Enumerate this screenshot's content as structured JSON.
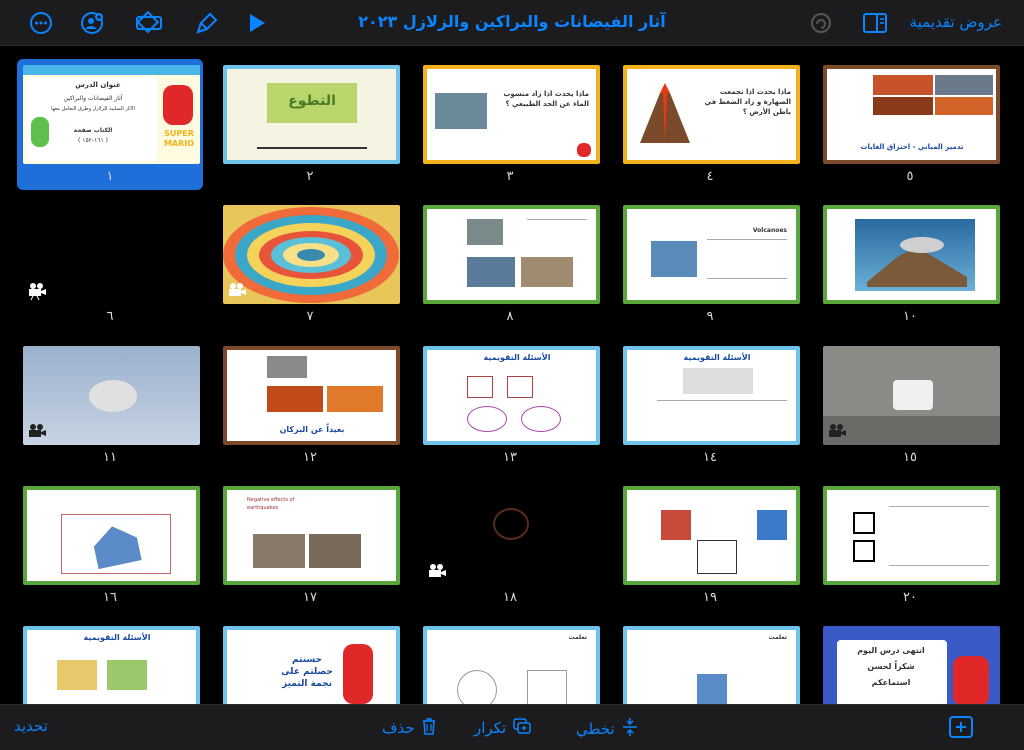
{
  "toolbar": {
    "title": "آثار الفيضانات والبراكين والزلازل ٢٠٢٣",
    "presentations": "عروض تقديمية",
    "more_icon": "ellipsis-circle-icon",
    "collab_icon": "add-person-icon",
    "animate_icon": "diamond-icon",
    "format_icon": "paintbrush-icon",
    "play_icon": "play-icon",
    "redo_icon": "redo-icon",
    "sidebar_icon": "sidebar-icon"
  },
  "slides": [
    {
      "n": "١",
      "selected": true,
      "title": "عنوان الدرس",
      "line1": "آثار الفيضانات والبراكين",
      "line2": "الآثار السلبية للزلازل وطرق التعامل معها",
      "line3": "الكتاب صفحة",
      "line4": "( ١٦١-١٥٢ )",
      "logo": "SUPER MARIO"
    },
    {
      "n": "٢",
      "title": "التطوع"
    },
    {
      "n": "٣",
      "title": "ماذا يحدث اذا زاد منسوب الماء عن الحد الطبيعي ؟"
    },
    {
      "n": "٤",
      "title": "ماذا يحدث اذا تجمعت الصهارة و زاد الضغط في باطن الأرض ؟"
    },
    {
      "n": "٥",
      "title": "تدمير المباني - احتراق الغابات"
    },
    {
      "n": "٦",
      "video": true
    },
    {
      "n": "٧",
      "video": true
    },
    {
      "n": "٨"
    },
    {
      "n": "٩",
      "title": "Volcanoes"
    },
    {
      "n": "١٠"
    },
    {
      "n": "١١",
      "video": true
    },
    {
      "n": "١٢",
      "title": "بعيداً عن البركان"
    },
    {
      "n": "١٣",
      "title": "الأسئلة التقويمية"
    },
    {
      "n": "١٤",
      "title": "الأسئلة التقويمية"
    },
    {
      "n": "١٥",
      "video": true
    },
    {
      "n": "١٦"
    },
    {
      "n": "١٧",
      "title": "Negative effects of earthquakes"
    },
    {
      "n": "١٨",
      "video": true
    },
    {
      "n": "١٩"
    },
    {
      "n": "٢٠"
    },
    {
      "n": "",
      "title": "الأسئلة التقويمية"
    },
    {
      "n": "",
      "title": "حسنتم حصلتم على نجمة التميز"
    },
    {
      "n": "",
      "title": "تعلمت"
    },
    {
      "n": "",
      "title": "تعلمت"
    },
    {
      "n": "",
      "title": "انتهى درس اليوم",
      "line1": "شكراً لحسن",
      "line2": "استماعكم"
    }
  ],
  "bottombar": {
    "edit": "تحديد",
    "delete": "حذف",
    "duplicate": "تكرار",
    "skip": "تخطي",
    "add_icon": "add-slide-icon"
  }
}
